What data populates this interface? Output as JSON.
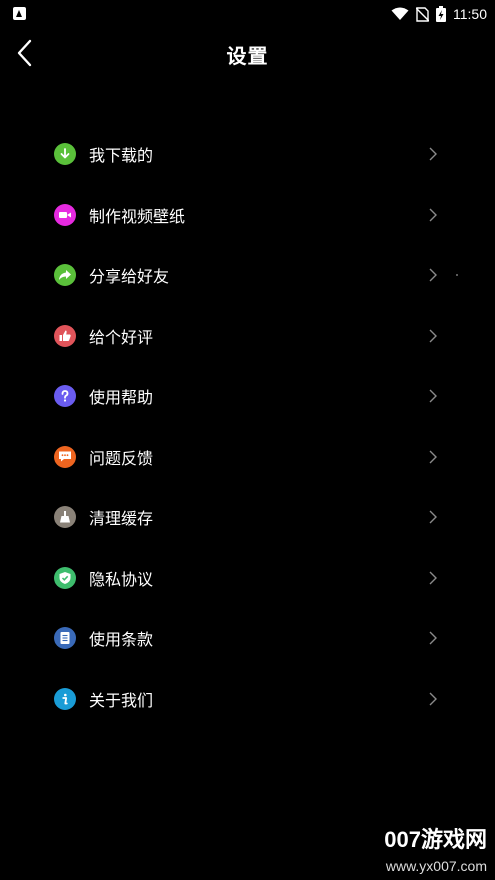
{
  "status_bar": {
    "time": "11:50"
  },
  "header": {
    "title": "设置"
  },
  "menu": [
    {
      "label": "我下载的",
      "icon": "download-icon",
      "color": "#5ac03a"
    },
    {
      "label": "制作视频壁纸",
      "icon": "video-camera-icon",
      "color": "#e62ae0"
    },
    {
      "label": "分享给好友",
      "icon": "share-icon",
      "color": "#5ac03a"
    },
    {
      "label": "给个好评",
      "icon": "thumbs-up-icon",
      "color": "#e0545a"
    },
    {
      "label": "使用帮助",
      "icon": "help-icon",
      "color": "#6a5cf0"
    },
    {
      "label": "问题反馈",
      "icon": "feedback-icon",
      "color": "#ee6520"
    },
    {
      "label": "清理缓存",
      "icon": "broom-icon",
      "color": "#8a8278"
    },
    {
      "label": "隐私协议",
      "icon": "shield-icon",
      "color": "#3ebd6d"
    },
    {
      "label": "使用条款",
      "icon": "document-icon",
      "color": "#3a6ab8"
    },
    {
      "label": "关于我们",
      "icon": "info-icon",
      "color": "#1a9cd6"
    }
  ],
  "watermark": {
    "main": "007游戏网",
    "sub": "www.yx007.com"
  }
}
